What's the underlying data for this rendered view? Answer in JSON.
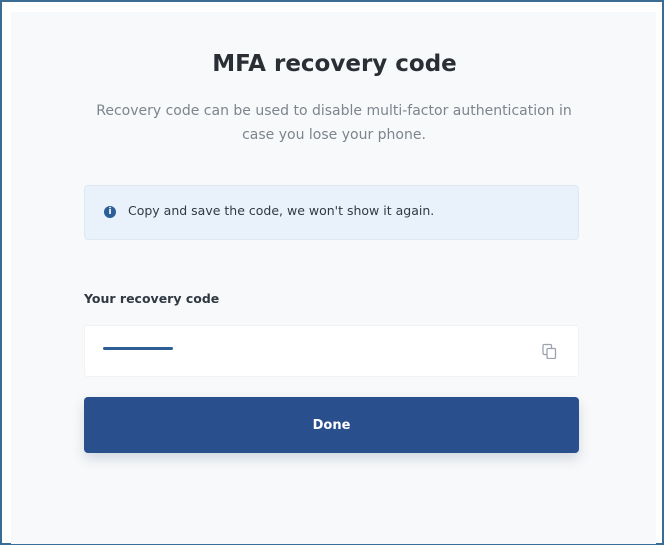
{
  "dialog": {
    "title": "MFA recovery code",
    "subtitle": "Recovery code can be used to disable multi-factor authentication in case you lose your phone."
  },
  "alert": {
    "icon": "info-icon",
    "text": "Copy and save the code, we won't show it again."
  },
  "recovery_field": {
    "label": "Your recovery code",
    "copy_icon": "copy-icon"
  },
  "actions": {
    "done_label": "Done"
  },
  "colors": {
    "frame_border": "#3a6c94",
    "alert_background": "#e9f2fb",
    "primary_button": "#2a4f8d"
  }
}
